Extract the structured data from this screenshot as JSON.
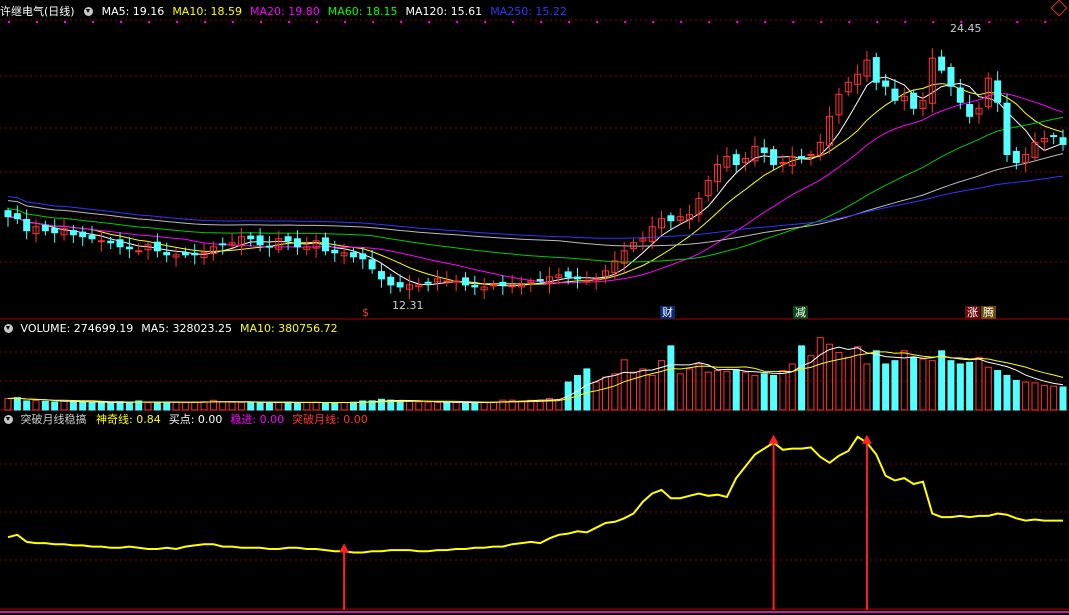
{
  "stock": {
    "title": "许继电气(日线)"
  },
  "main_legend": [
    {
      "label": "MA5: 19.16",
      "color": "#ffffff"
    },
    {
      "label": "MA10: 18.59",
      "color": "#ffff00"
    },
    {
      "label": "MA20: 19.80",
      "color": "#ff00ff"
    },
    {
      "label": "MA60: 18.15",
      "color": "#00ff00"
    },
    {
      "label": "MA120: 15.61",
      "color": "#ffffff"
    },
    {
      "label": "MA250: 15.22",
      "color": "#3333ff"
    }
  ],
  "volume_legend": [
    {
      "label": "VOLUME: 274699.19",
      "color": "#ffffff"
    },
    {
      "label": "MA5: 328023.25",
      "color": "#ffffff"
    },
    {
      "label": "MA10: 380756.72",
      "color": "#ffff00"
    }
  ],
  "indicator_legend": {
    "name": "突破月线稳搞",
    "items": [
      {
        "label": "神奇线: 0.84",
        "color": "#ffff00"
      },
      {
        "label": "买点: 0.00",
        "color": "#ffffff"
      },
      {
        "label": "稳进: 0.00",
        "color": "#ff00ff"
      },
      {
        "label": "突破月线: 0.00",
        "color": "#ff3333"
      }
    ]
  },
  "price_annotations": {
    "high": "24.45",
    "low": "12.31"
  },
  "event_markers": [
    {
      "label": "$",
      "color": "#ff3333"
    },
    {
      "label": "财",
      "color": "#4aa0ff"
    },
    {
      "label": "减",
      "color": "#33cc33"
    },
    {
      "label": "涨",
      "color": "#ff3333"
    },
    {
      "label": "腾",
      "color": "#ffcc00"
    }
  ],
  "colors": {
    "up": "#ff3232",
    "down": "#54ffff",
    "grid": "#8a0000",
    "indicator": "#ffff00",
    "arrow": "#ff2020"
  },
  "chart_data": {
    "type": "candlestick",
    "ohlc_close": [
      16.0,
      15.9,
      15.3,
      15.5,
      15.3,
      15.2,
      15.4,
      15.1,
      15.0,
      14.9,
      14.8,
      14.7,
      14.5,
      14.4,
      14.3,
      14.6,
      14.3,
      14.1,
      14.1,
      14.1,
      14.1,
      14.2,
      14.5,
      14.6,
      14.7,
      15.0,
      14.9,
      14.6,
      14.5,
      14.9,
      14.8,
      14.5,
      14.5,
      14.8,
      14.3,
      14.2,
      14.2,
      14.0,
      13.9,
      13.4,
      12.9,
      12.6,
      12.5,
      12.6,
      12.6,
      12.7,
      12.9,
      12.8,
      12.8,
      12.6,
      12.5,
      12.5,
      12.6,
      12.6,
      12.6,
      12.6,
      12.8,
      12.8,
      13.0,
      13.1,
      13.0,
      12.9,
      12.8,
      12.9,
      13.3,
      13.8,
      14.3,
      14.7,
      14.9,
      15.5,
      15.9,
      15.8,
      16.0,
      16.1,
      16.9,
      17.8,
      18.6,
      19.0,
      18.6,
      18.9,
      19.5,
      19.2,
      18.6,
      18.7,
      19.0,
      18.9,
      19.1,
      19.7,
      21.0,
      22.1,
      22.7,
      23.1,
      23.8,
      22.7,
      22.5,
      21.8,
      22.0,
      21.4,
      21.8,
      23.9,
      23.3,
      22.5,
      21.7,
      21.0,
      21.4,
      22.9,
      21.7,
      19.1,
      18.7,
      19.1,
      19.7,
      19.9,
      20.0,
      19.6
    ],
    "volume": [
      140000,
      150000,
      110000,
      115000,
      105000,
      98000,
      110000,
      100000,
      95000,
      90000,
      92000,
      88000,
      100000,
      92000,
      110000,
      90000,
      92000,
      95000,
      98000,
      92000,
      95000,
      100000,
      118000,
      100000,
      95000,
      92000,
      95000,
      88000,
      90000,
      92000,
      96000,
      88000,
      92000,
      92000,
      90000,
      88000,
      92000,
      95000,
      110000,
      112000,
      130000,
      120000,
      110000,
      105000,
      98000,
      95000,
      92000,
      90000,
      92000,
      90000,
      95000,
      92000,
      95000,
      120000,
      120000,
      110000,
      118000,
      120000,
      140000,
      130000,
      340000,
      420000,
      500000,
      340000,
      400000,
      440000,
      610000,
      460000,
      500000,
      420000,
      600000,
      780000,
      440000,
      500000,
      560000,
      460000,
      480000,
      470000,
      490000,
      460000,
      420000,
      440000,
      420000,
      480000,
      560000,
      780000,
      660000,
      880000,
      800000,
      700000,
      640000,
      770000,
      560000,
      720000,
      560000,
      600000,
      720000,
      640000,
      620000,
      600000,
      720000,
      600000,
      560000,
      580000,
      640000,
      520000,
      480000,
      420000,
      360000,
      340000,
      330000,
      300000,
      290000,
      280000
    ],
    "indicator": {
      "name": "神奇线",
      "values": [
        0.6,
        0.62,
        0.56,
        0.55,
        0.55,
        0.54,
        0.54,
        0.53,
        0.53,
        0.52,
        0.52,
        0.51,
        0.51,
        0.52,
        0.51,
        0.5,
        0.5,
        0.51,
        0.5,
        0.52,
        0.53,
        0.54,
        0.54,
        0.52,
        0.52,
        0.51,
        0.51,
        0.51,
        0.5,
        0.5,
        0.51,
        0.51,
        0.5,
        0.5,
        0.49,
        0.48,
        0.48,
        0.47,
        0.47,
        0.48,
        0.48,
        0.49,
        0.49,
        0.49,
        0.48,
        0.48,
        0.49,
        0.49,
        0.5,
        0.5,
        0.51,
        0.51,
        0.52,
        0.52,
        0.54,
        0.55,
        0.56,
        0.55,
        0.59,
        0.62,
        0.63,
        0.65,
        0.64,
        0.68,
        0.72,
        0.73,
        0.76,
        0.8,
        0.9,
        0.97,
        1.0,
        0.93,
        0.93,
        0.95,
        0.97,
        0.95,
        0.96,
        0.94,
        1.1,
        1.2,
        1.3,
        1.35,
        1.4,
        1.34,
        1.35,
        1.35,
        1.36,
        1.28,
        1.23,
        1.29,
        1.33,
        1.45,
        1.4,
        1.3,
        1.12,
        1.08,
        1.1,
        1.05,
        1.07,
        0.8,
        0.77,
        0.77,
        0.78,
        0.77,
        0.78,
        0.78,
        0.8,
        0.79,
        0.76,
        0.74,
        0.75,
        0.74,
        0.74,
        0.74
      ],
      "buy_signals": [
        36,
        82,
        92
      ]
    }
  }
}
